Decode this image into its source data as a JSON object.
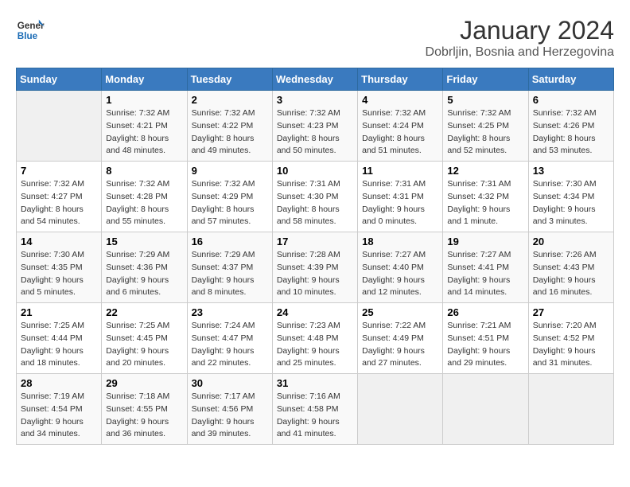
{
  "header": {
    "logo_line1": "General",
    "logo_line2": "Blue",
    "month": "January 2024",
    "location": "Dobrljin, Bosnia and Herzegovina"
  },
  "weekdays": [
    "Sunday",
    "Monday",
    "Tuesday",
    "Wednesday",
    "Thursday",
    "Friday",
    "Saturday"
  ],
  "weeks": [
    [
      {
        "day": "",
        "sunrise": "",
        "sunset": "",
        "daylight": ""
      },
      {
        "day": "1",
        "sunrise": "Sunrise: 7:32 AM",
        "sunset": "Sunset: 4:21 PM",
        "daylight": "Daylight: 8 hours and 48 minutes."
      },
      {
        "day": "2",
        "sunrise": "Sunrise: 7:32 AM",
        "sunset": "Sunset: 4:22 PM",
        "daylight": "Daylight: 8 hours and 49 minutes."
      },
      {
        "day": "3",
        "sunrise": "Sunrise: 7:32 AM",
        "sunset": "Sunset: 4:23 PM",
        "daylight": "Daylight: 8 hours and 50 minutes."
      },
      {
        "day": "4",
        "sunrise": "Sunrise: 7:32 AM",
        "sunset": "Sunset: 4:24 PM",
        "daylight": "Daylight: 8 hours and 51 minutes."
      },
      {
        "day": "5",
        "sunrise": "Sunrise: 7:32 AM",
        "sunset": "Sunset: 4:25 PM",
        "daylight": "Daylight: 8 hours and 52 minutes."
      },
      {
        "day": "6",
        "sunrise": "Sunrise: 7:32 AM",
        "sunset": "Sunset: 4:26 PM",
        "daylight": "Daylight: 8 hours and 53 minutes."
      }
    ],
    [
      {
        "day": "7",
        "sunrise": "Sunrise: 7:32 AM",
        "sunset": "Sunset: 4:27 PM",
        "daylight": "Daylight: 8 hours and 54 minutes."
      },
      {
        "day": "8",
        "sunrise": "Sunrise: 7:32 AM",
        "sunset": "Sunset: 4:28 PM",
        "daylight": "Daylight: 8 hours and 55 minutes."
      },
      {
        "day": "9",
        "sunrise": "Sunrise: 7:32 AM",
        "sunset": "Sunset: 4:29 PM",
        "daylight": "Daylight: 8 hours and 57 minutes."
      },
      {
        "day": "10",
        "sunrise": "Sunrise: 7:31 AM",
        "sunset": "Sunset: 4:30 PM",
        "daylight": "Daylight: 8 hours and 58 minutes."
      },
      {
        "day": "11",
        "sunrise": "Sunrise: 7:31 AM",
        "sunset": "Sunset: 4:31 PM",
        "daylight": "Daylight: 9 hours and 0 minutes."
      },
      {
        "day": "12",
        "sunrise": "Sunrise: 7:31 AM",
        "sunset": "Sunset: 4:32 PM",
        "daylight": "Daylight: 9 hours and 1 minute."
      },
      {
        "day": "13",
        "sunrise": "Sunrise: 7:30 AM",
        "sunset": "Sunset: 4:34 PM",
        "daylight": "Daylight: 9 hours and 3 minutes."
      }
    ],
    [
      {
        "day": "14",
        "sunrise": "Sunrise: 7:30 AM",
        "sunset": "Sunset: 4:35 PM",
        "daylight": "Daylight: 9 hours and 5 minutes."
      },
      {
        "day": "15",
        "sunrise": "Sunrise: 7:29 AM",
        "sunset": "Sunset: 4:36 PM",
        "daylight": "Daylight: 9 hours and 6 minutes."
      },
      {
        "day": "16",
        "sunrise": "Sunrise: 7:29 AM",
        "sunset": "Sunset: 4:37 PM",
        "daylight": "Daylight: 9 hours and 8 minutes."
      },
      {
        "day": "17",
        "sunrise": "Sunrise: 7:28 AM",
        "sunset": "Sunset: 4:39 PM",
        "daylight": "Daylight: 9 hours and 10 minutes."
      },
      {
        "day": "18",
        "sunrise": "Sunrise: 7:27 AM",
        "sunset": "Sunset: 4:40 PM",
        "daylight": "Daylight: 9 hours and 12 minutes."
      },
      {
        "day": "19",
        "sunrise": "Sunrise: 7:27 AM",
        "sunset": "Sunset: 4:41 PM",
        "daylight": "Daylight: 9 hours and 14 minutes."
      },
      {
        "day": "20",
        "sunrise": "Sunrise: 7:26 AM",
        "sunset": "Sunset: 4:43 PM",
        "daylight": "Daylight: 9 hours and 16 minutes."
      }
    ],
    [
      {
        "day": "21",
        "sunrise": "Sunrise: 7:25 AM",
        "sunset": "Sunset: 4:44 PM",
        "daylight": "Daylight: 9 hours and 18 minutes."
      },
      {
        "day": "22",
        "sunrise": "Sunrise: 7:25 AM",
        "sunset": "Sunset: 4:45 PM",
        "daylight": "Daylight: 9 hours and 20 minutes."
      },
      {
        "day": "23",
        "sunrise": "Sunrise: 7:24 AM",
        "sunset": "Sunset: 4:47 PM",
        "daylight": "Daylight: 9 hours and 22 minutes."
      },
      {
        "day": "24",
        "sunrise": "Sunrise: 7:23 AM",
        "sunset": "Sunset: 4:48 PM",
        "daylight": "Daylight: 9 hours and 25 minutes."
      },
      {
        "day": "25",
        "sunrise": "Sunrise: 7:22 AM",
        "sunset": "Sunset: 4:49 PM",
        "daylight": "Daylight: 9 hours and 27 minutes."
      },
      {
        "day": "26",
        "sunrise": "Sunrise: 7:21 AM",
        "sunset": "Sunset: 4:51 PM",
        "daylight": "Daylight: 9 hours and 29 minutes."
      },
      {
        "day": "27",
        "sunrise": "Sunrise: 7:20 AM",
        "sunset": "Sunset: 4:52 PM",
        "daylight": "Daylight: 9 hours and 31 minutes."
      }
    ],
    [
      {
        "day": "28",
        "sunrise": "Sunrise: 7:19 AM",
        "sunset": "Sunset: 4:54 PM",
        "daylight": "Daylight: 9 hours and 34 minutes."
      },
      {
        "day": "29",
        "sunrise": "Sunrise: 7:18 AM",
        "sunset": "Sunset: 4:55 PM",
        "daylight": "Daylight: 9 hours and 36 minutes."
      },
      {
        "day": "30",
        "sunrise": "Sunrise: 7:17 AM",
        "sunset": "Sunset: 4:56 PM",
        "daylight": "Daylight: 9 hours and 39 minutes."
      },
      {
        "day": "31",
        "sunrise": "Sunrise: 7:16 AM",
        "sunset": "Sunset: 4:58 PM",
        "daylight": "Daylight: 9 hours and 41 minutes."
      },
      {
        "day": "",
        "sunrise": "",
        "sunset": "",
        "daylight": ""
      },
      {
        "day": "",
        "sunrise": "",
        "sunset": "",
        "daylight": ""
      },
      {
        "day": "",
        "sunrise": "",
        "sunset": "",
        "daylight": ""
      }
    ]
  ]
}
